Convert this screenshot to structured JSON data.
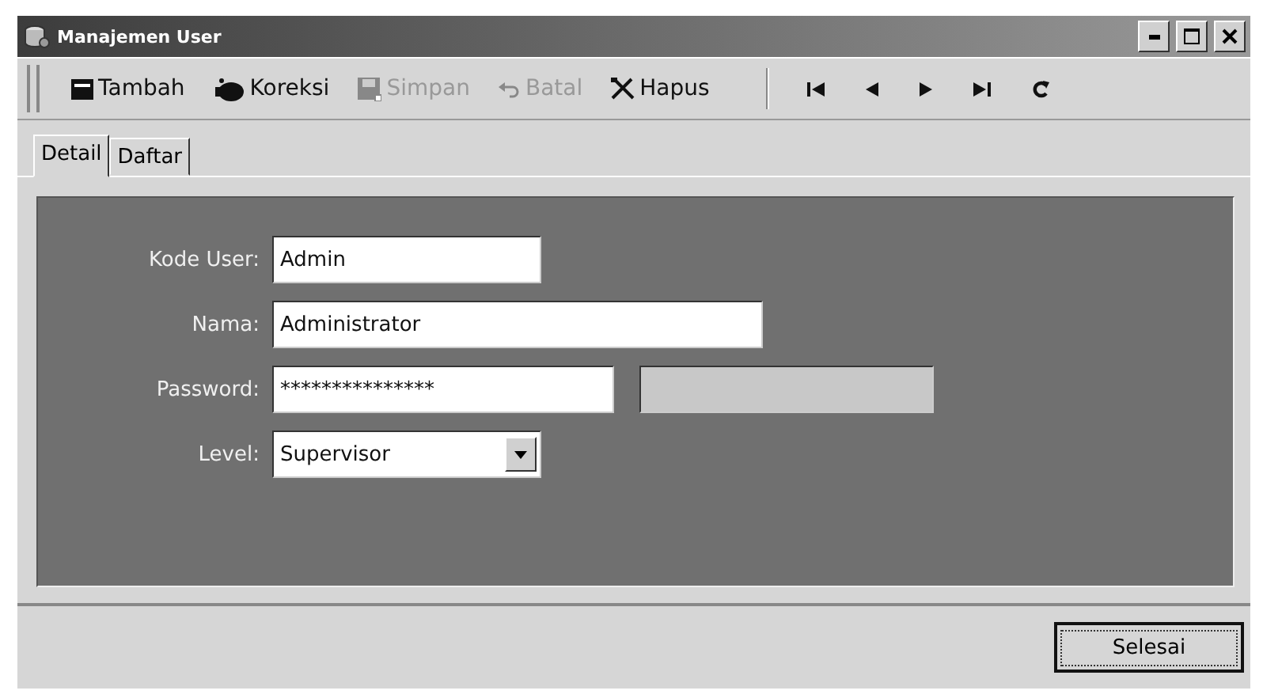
{
  "window": {
    "title": "Manajemen User"
  },
  "toolbar": [
    {
      "kind": "button",
      "label": "Tambah",
      "disabled": false
    },
    {
      "kind": "button",
      "label": "Koreksi",
      "disabled": false
    },
    {
      "kind": "button",
      "label": "Simpan",
      "disabled": true
    },
    {
      "kind": "button",
      "label": "Batal",
      "disabled": true
    },
    {
      "kind": "button",
      "label": "Hapus",
      "disabled": false
    },
    {
      "kind": "separator"
    },
    {
      "kind": "nav"
    },
    {
      "kind": "nav"
    },
    {
      "kind": "nav"
    },
    {
      "kind": "nav"
    },
    {
      "kind": "nav"
    }
  ],
  "tabs": [
    {
      "label": "Detail",
      "selected": true
    },
    {
      "label": "Daftar",
      "selected": false
    }
  ],
  "form": [
    {
      "kind": "text",
      "label": "Kode User:",
      "value": "Admin"
    },
    {
      "kind": "text",
      "label": "Nama:",
      "value": "Administrator"
    },
    {
      "kind": "password",
      "label": "Password:",
      "value": "***************",
      "extra_disabled": true
    },
    {
      "kind": "select",
      "label": "Level:",
      "value": "Supervisor"
    }
  ],
  "footer": {
    "button": "Selesai"
  }
}
